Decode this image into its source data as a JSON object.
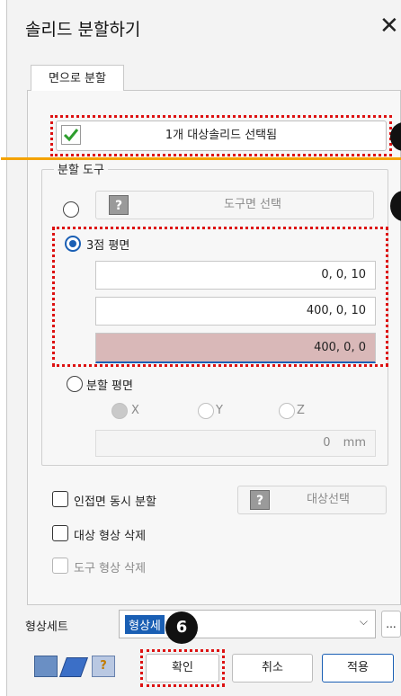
{
  "window": {
    "title": "솔리드 분할하기",
    "close_glyph": "✕"
  },
  "tabs": [
    {
      "label": "면으로 분할"
    }
  ],
  "target_button": {
    "label": "1개 대상솔리드 선택됨"
  },
  "tool_group": {
    "legend": "분할 도구",
    "tool_face_button": "도구면 선택",
    "three_point": {
      "label": "3점 평면",
      "points": [
        "0, 0, 10",
        "400, 0, 10",
        "400, 0, 0"
      ]
    },
    "split_plane": {
      "label": "분할 평면",
      "axes": [
        "X",
        "Y",
        "Z"
      ],
      "offset_value": "0",
      "unit": "mm"
    }
  },
  "options": {
    "adjacent_split": "인접면 동시 분할",
    "target_select": "대상선택",
    "delete_target": "대상 형상 삭제",
    "delete_tool": "도구 형상 삭제"
  },
  "shape_set": {
    "label": "형상세트",
    "value": "형상세",
    "more": "..."
  },
  "buttons": {
    "ok": "확인",
    "cancel": "취소",
    "apply": "적용"
  },
  "badges": {
    "ok_badge": "6"
  },
  "colors": {
    "accent": "#1a5fb4",
    "highlight_dots": "#d11111",
    "guide_line": "#f4a300",
    "active_field": "#d9b8b8"
  }
}
